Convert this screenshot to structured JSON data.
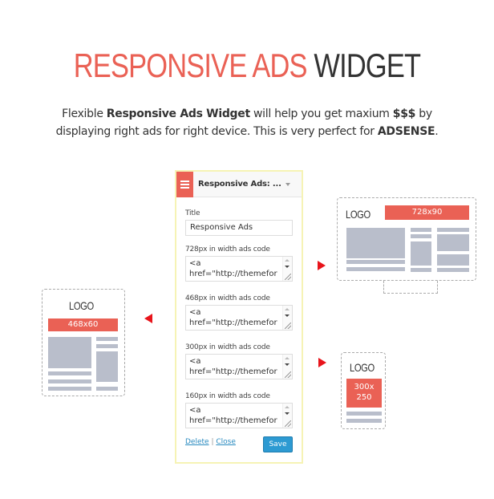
{
  "header": {
    "title_accent": "RESPONSIVE ADS",
    "title_dark": "WIDGET",
    "subtitle_line1": {
      "pre": "Flexible ",
      "bold1": "Responsive Ads Widget",
      "mid": " will help you get maxium ",
      "bold2": "$$$",
      "post": " by"
    },
    "subtitle_line2": {
      "pre": "displaying right ads for right device. This is very perfect for ",
      "bold": "ADSENSE",
      "post": "."
    }
  },
  "widget": {
    "header_title": "Responsive Ads: ...",
    "handle_icon": "menu-icon",
    "toggle_icon": "caret-down-icon",
    "title_label": "Title",
    "title_value": "Responsive Ads",
    "fields": [
      {
        "label": "728px in width ads code",
        "line1": "<a",
        "line2": "href=\"http://themefor"
      },
      {
        "label": "468px in width ads code",
        "line1": "<a",
        "line2": "href=\"http://themefor"
      },
      {
        "label": "300px in width ads code",
        "line1": "<a",
        "line2": "href=\"http://themefor"
      },
      {
        "label": "160px in width ads code",
        "line1": "<a",
        "line2": "href=\"http://themefor"
      }
    ],
    "delete_label": "Delete",
    "separator": "|",
    "close_label": "Close",
    "save_label": "Save"
  },
  "devices": {
    "desktop": {
      "logo": "LOGO",
      "ad_size": "728x90"
    },
    "tablet": {
      "logo": "LOGO",
      "ad_size": "468x60"
    },
    "mobile": {
      "logo": "LOGO",
      "ad_size_line1": "300x",
      "ad_size_line2": "250"
    }
  },
  "colors": {
    "accent": "#ea6155",
    "dark": "#333333",
    "placeholder_gray": "#b9becb",
    "arrow_red": "#e8141b",
    "save_blue": "#2d9ad2",
    "link_blue": "#2a8bc0"
  }
}
